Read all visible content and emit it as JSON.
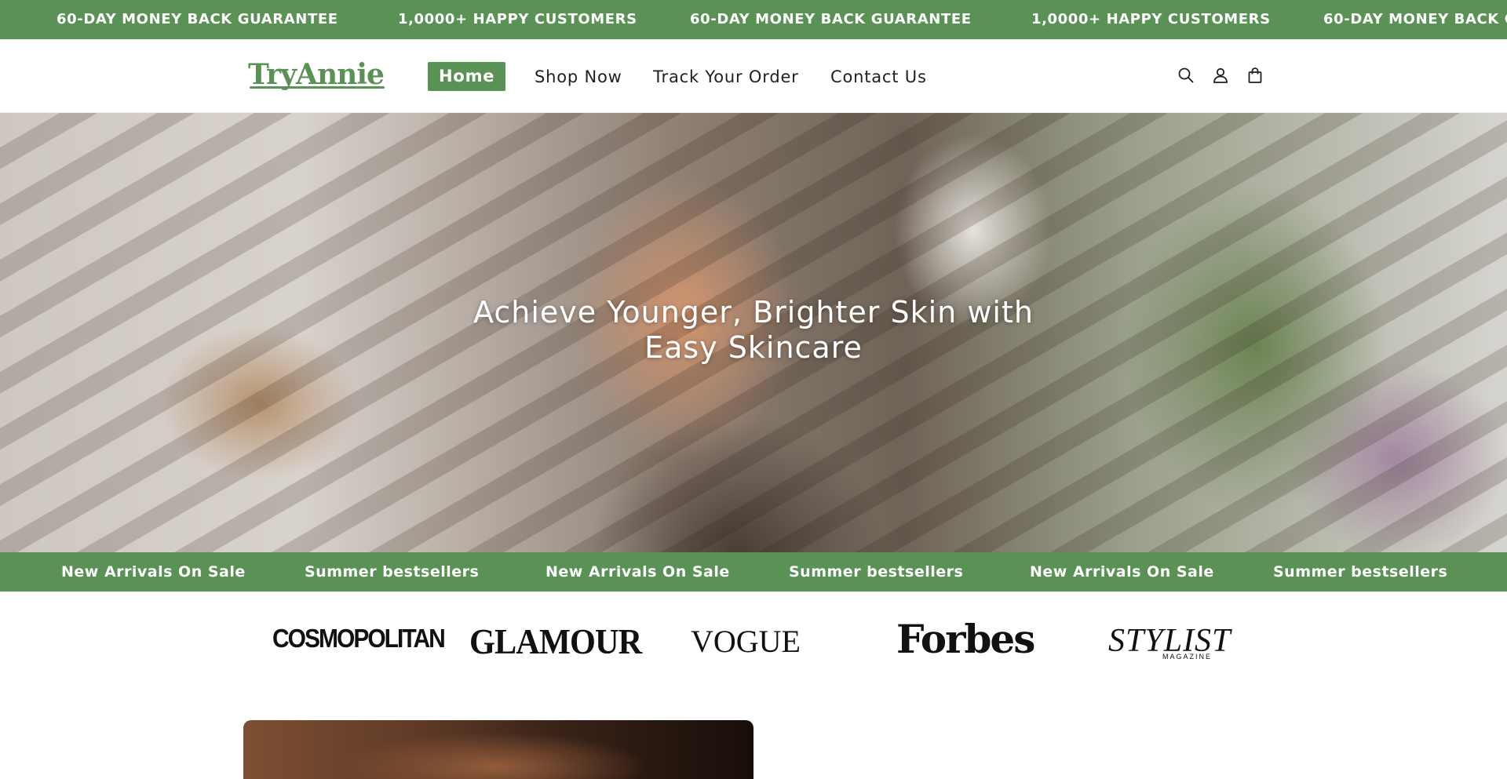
{
  "announcement_bar": {
    "items": [
      "60-DAY MONEY BACK GUARANTEE",
      "1,0000+ HAPPY CUSTOMERS",
      "60-DAY MONEY BACK GUARANTEE",
      "1,0000+ HAPPY CUSTOMERS",
      "60-DAY MONEY BACK G"
    ],
    "background": "#5a9256"
  },
  "header": {
    "logo": "TryAnnie",
    "nav": [
      "Home",
      "Shop Now",
      "Track Your Order",
      "Contact Us"
    ],
    "active_nav": "Home",
    "icons": [
      "search-icon",
      "account-icon",
      "cart-icon"
    ]
  },
  "hero": {
    "title": "Achieve Younger, Brighter Skin with Easy Skincare"
  },
  "promo_bar": {
    "items": [
      "New Arrivals On Sale",
      "Summer bestsellers",
      "New Arrivals On Sale",
      "Summer bestsellers",
      "New Arrivals On Sale",
      "Summer bestsellers"
    ]
  },
  "press_logos": {
    "cosmopolitan": "COSMOPOLITAN",
    "glamour": "GLAMOUR",
    "vogue": "VOGUE",
    "forbes": "Forbes",
    "stylist": "STYLIST",
    "stylist_sub": "MAGAZINE"
  },
  "colors": {
    "brand_green": "#5a9256",
    "text_dark": "#1f1f1f",
    "white": "#ffffff"
  }
}
